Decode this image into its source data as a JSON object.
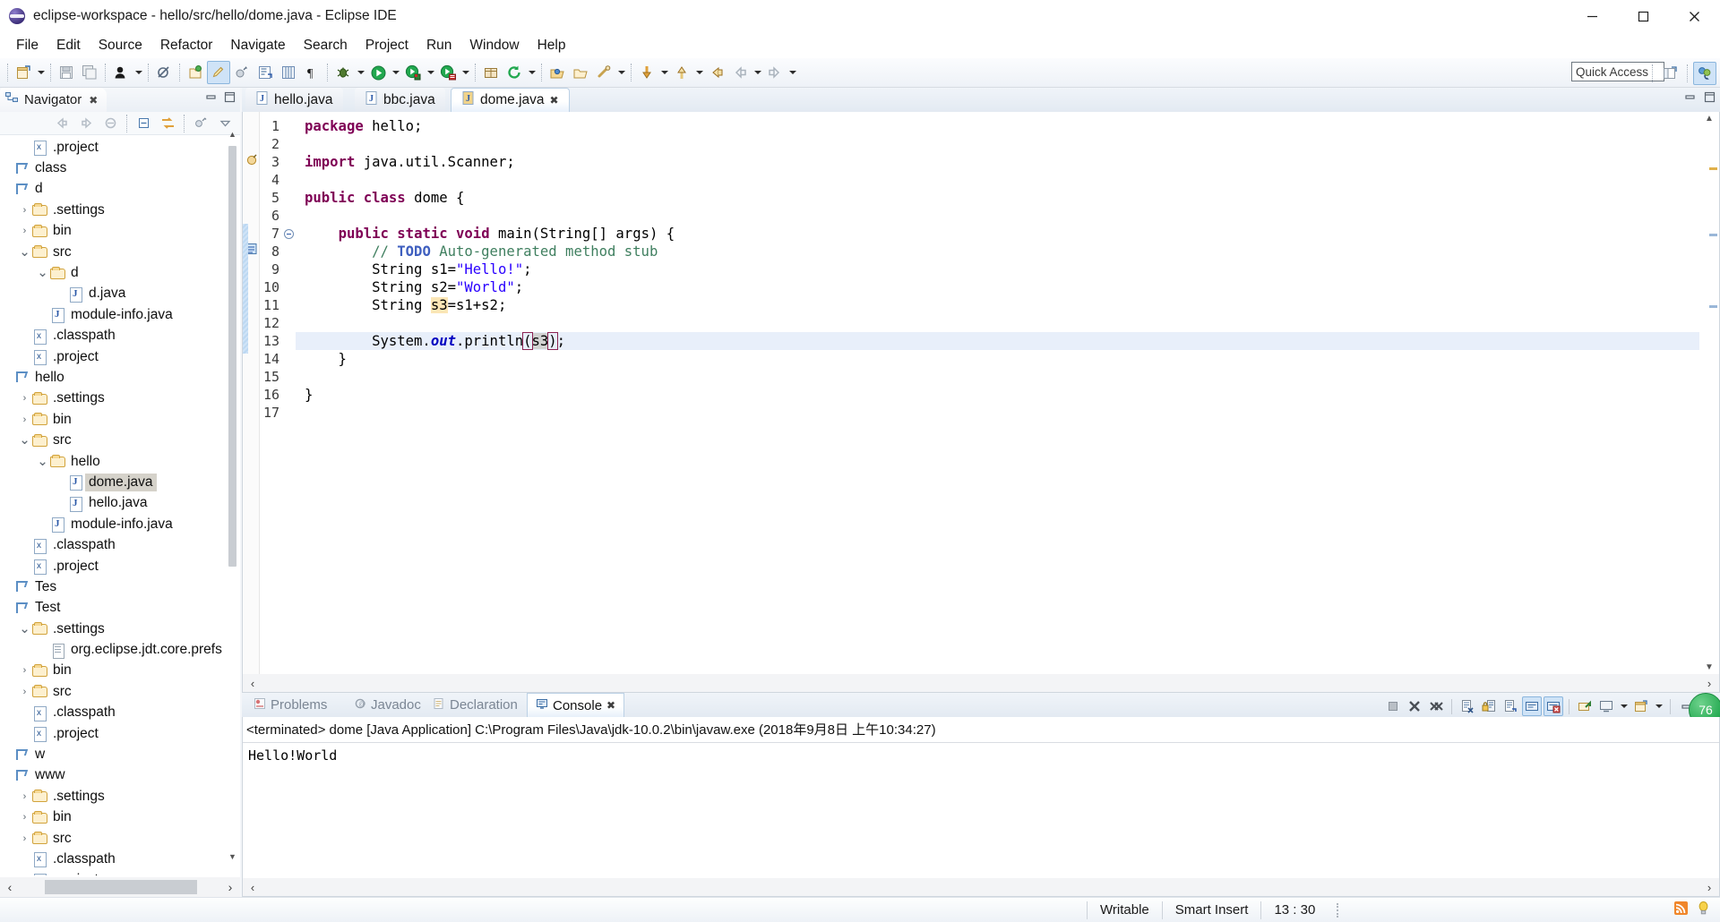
{
  "window": {
    "title": "eclipse-workspace - hello/src/hello/dome.java - Eclipse IDE",
    "logo": "eclipse-logo",
    "minimize": "minimize-icon",
    "maximize": "maximize-icon",
    "close": "close-icon"
  },
  "menubar": {
    "items": [
      {
        "label": "File"
      },
      {
        "label": "Edit"
      },
      {
        "label": "Source"
      },
      {
        "label": "Refactor"
      },
      {
        "label": "Navigate"
      },
      {
        "label": "Search"
      },
      {
        "label": "Project"
      },
      {
        "label": "Run"
      },
      {
        "label": "Window"
      },
      {
        "label": "Help"
      }
    ]
  },
  "toolbar": {
    "quick_access_placeholder": "Quick Access",
    "items": [
      {
        "name": "new-wizard-icon"
      },
      {
        "name": "new-dropdown-icon"
      },
      {
        "name": "save-icon"
      },
      {
        "name": "save-all-icon"
      },
      {
        "name": "toggle-breadcrumb-icon"
      },
      {
        "name": "breadcrumb-dropdown-icon"
      },
      {
        "name": "skip-breakpoints-icon"
      },
      {
        "name": "new-java-project-icon"
      },
      {
        "name": "new-java-class-icon"
      },
      {
        "name": "new-annotation-icon"
      },
      {
        "name": "open-type-icon"
      },
      {
        "name": "show-whitespace-icon"
      },
      {
        "name": "debug-icon"
      },
      {
        "name": "debug-dropdown-icon"
      },
      {
        "name": "run-icon"
      },
      {
        "name": "run-dropdown-icon"
      },
      {
        "name": "run-coverage-icon"
      },
      {
        "name": "coverage-dropdown-icon"
      },
      {
        "name": "external-tools-icon"
      },
      {
        "name": "external-tools-dropdown-icon"
      },
      {
        "name": "new-package-icon"
      },
      {
        "name": "refresh-icon"
      },
      {
        "name": "refresh-dropdown-icon"
      },
      {
        "name": "open-task-icon"
      },
      {
        "name": "open-folder-icon"
      },
      {
        "name": "link-icon"
      },
      {
        "name": "link-dropdown-icon"
      },
      {
        "name": "next-annotation-icon"
      },
      {
        "name": "next-dropdown-icon"
      },
      {
        "name": "previous-annotation-icon"
      },
      {
        "name": "previous-dropdown-icon"
      },
      {
        "name": "last-edit-location-icon"
      },
      {
        "name": "back-icon"
      },
      {
        "name": "back-dropdown-icon"
      },
      {
        "name": "forward-icon"
      },
      {
        "name": "forward-dropdown-icon"
      }
    ],
    "perspective": [
      {
        "name": "open-perspective-icon"
      },
      {
        "name": "java-perspective-icon"
      }
    ]
  },
  "navigator": {
    "tab_label": "Navigator",
    "tab_icon": "navigator-icon",
    "close_icon": "close-icon",
    "minimize_icon": "minimize-view-icon",
    "maximize_icon": "maximize-view-icon",
    "toolbar": [
      {
        "name": "back-icon"
      },
      {
        "name": "forward-icon"
      },
      {
        "name": "home-icon"
      },
      {
        "name": "collapse-all-icon"
      },
      {
        "name": "link-with-editor-icon"
      },
      {
        "name": "filters-icon"
      },
      {
        "name": "view-menu-icon"
      }
    ],
    "tree": [
      {
        "indent": 1,
        "twisty": "",
        "icon": "x-file-icon",
        "label": ".project",
        "selected": false
      },
      {
        "indent": 0,
        "twisty": "",
        "icon": "project-icon",
        "label": "class",
        "selected": false
      },
      {
        "indent": 0,
        "twisty": "",
        "icon": "project-icon",
        "label": "d",
        "selected": false
      },
      {
        "indent": 1,
        "twisty": ">",
        "icon": "folder-icon",
        "label": ".settings",
        "selected": false
      },
      {
        "indent": 1,
        "twisty": ">",
        "icon": "folder-icon",
        "label": "bin",
        "selected": false
      },
      {
        "indent": 1,
        "twisty": "v",
        "icon": "folder-icon",
        "label": "src",
        "selected": false
      },
      {
        "indent": 2,
        "twisty": "v",
        "icon": "folder-icon",
        "label": "d",
        "selected": false
      },
      {
        "indent": 3,
        "twisty": "",
        "icon": "java-file-icon",
        "label": "d.java",
        "selected": false
      },
      {
        "indent": 2,
        "twisty": "",
        "icon": "java-file-icon",
        "label": "module-info.java",
        "selected": false
      },
      {
        "indent": 1,
        "twisty": "",
        "icon": "x-file-icon",
        "label": ".classpath",
        "selected": false
      },
      {
        "indent": 1,
        "twisty": "",
        "icon": "x-file-icon",
        "label": ".project",
        "selected": false
      },
      {
        "indent": 0,
        "twisty": "",
        "icon": "project-icon",
        "label": "hello",
        "selected": false
      },
      {
        "indent": 1,
        "twisty": ">",
        "icon": "folder-icon",
        "label": ".settings",
        "selected": false
      },
      {
        "indent": 1,
        "twisty": ">",
        "icon": "folder-icon",
        "label": "bin",
        "selected": false
      },
      {
        "indent": 1,
        "twisty": "v",
        "icon": "folder-icon",
        "label": "src",
        "selected": false
      },
      {
        "indent": 2,
        "twisty": "v",
        "icon": "folder-icon",
        "label": "hello",
        "selected": false
      },
      {
        "indent": 3,
        "twisty": "",
        "icon": "java-file-icon",
        "label": "dome.java",
        "selected": true
      },
      {
        "indent": 3,
        "twisty": "",
        "icon": "java-file-icon",
        "label": "hello.java",
        "selected": false
      },
      {
        "indent": 2,
        "twisty": "",
        "icon": "java-file-icon",
        "label": "module-info.java",
        "selected": false
      },
      {
        "indent": 1,
        "twisty": "",
        "icon": "x-file-icon",
        "label": ".classpath",
        "selected": false
      },
      {
        "indent": 1,
        "twisty": "",
        "icon": "x-file-icon",
        "label": ".project",
        "selected": false
      },
      {
        "indent": 0,
        "twisty": "",
        "icon": "project-icon",
        "label": "Tes",
        "selected": false
      },
      {
        "indent": 0,
        "twisty": "",
        "icon": "project-icon",
        "label": "Test",
        "selected": false
      },
      {
        "indent": 1,
        "twisty": "v",
        "icon": "folder-icon",
        "label": ".settings",
        "selected": false
      },
      {
        "indent": 2,
        "twisty": "",
        "icon": "text-file-icon",
        "label": "org.eclipse.jdt.core.prefs",
        "selected": false
      },
      {
        "indent": 1,
        "twisty": ">",
        "icon": "folder-icon",
        "label": "bin",
        "selected": false
      },
      {
        "indent": 1,
        "twisty": ">",
        "icon": "folder-icon",
        "label": "src",
        "selected": false
      },
      {
        "indent": 1,
        "twisty": "",
        "icon": "x-file-icon",
        "label": ".classpath",
        "selected": false
      },
      {
        "indent": 1,
        "twisty": "",
        "icon": "x-file-icon",
        "label": ".project",
        "selected": false
      },
      {
        "indent": 0,
        "twisty": "",
        "icon": "project-icon",
        "label": "w",
        "selected": false
      },
      {
        "indent": 0,
        "twisty": "",
        "icon": "project-icon",
        "label": "www",
        "selected": false
      },
      {
        "indent": 1,
        "twisty": ">",
        "icon": "folder-icon",
        "label": ".settings",
        "selected": false
      },
      {
        "indent": 1,
        "twisty": ">",
        "icon": "folder-icon",
        "label": "bin",
        "selected": false
      },
      {
        "indent": 1,
        "twisty": ">",
        "icon": "folder-icon",
        "label": "src",
        "selected": false
      },
      {
        "indent": 1,
        "twisty": "",
        "icon": "x-file-icon",
        "label": ".classpath",
        "selected": false
      },
      {
        "indent": 1,
        "twisty": "",
        "icon": "x-file-icon",
        "label": ".project",
        "selected": false
      }
    ],
    "hscroll_left": "‹",
    "hscroll_right": "›"
  },
  "editor": {
    "tabs": [
      {
        "label": "hello.java",
        "icon": "java-file-icon",
        "active": false,
        "closable": false
      },
      {
        "label": "bbc.java",
        "icon": "java-file-icon",
        "active": false,
        "closable": false
      },
      {
        "label": "dome.java",
        "icon": "java-file-icon-active",
        "active": true,
        "closable": true
      }
    ],
    "close_icon": "close-icon",
    "minimize_icon": "minimize-view-icon",
    "maximize_icon": "maximize-view-icon",
    "line_numbers": [
      "1",
      "2",
      "3",
      "4",
      "5",
      "6",
      "7",
      "8",
      "9",
      "10",
      "11",
      "12",
      "13",
      "14",
      "15",
      "16",
      "17"
    ],
    "fold_markers": {
      "7": "collapse-marker"
    },
    "markers": {
      "3": "warning-marker",
      "8": "todo-marker"
    },
    "current_line": 13,
    "lines": [
      {
        "n": 1,
        "text": "package hello;"
      },
      {
        "n": 2,
        "text": ""
      },
      {
        "n": 3,
        "text": "import java.util.Scanner;"
      },
      {
        "n": 4,
        "text": ""
      },
      {
        "n": 5,
        "text": "public class dome {"
      },
      {
        "n": 6,
        "text": ""
      },
      {
        "n": 7,
        "text": "    public static void main(String[] args) {"
      },
      {
        "n": 8,
        "text": "        // TODO Auto-generated method stub"
      },
      {
        "n": 9,
        "text": "        String s1=\"Hello!\";"
      },
      {
        "n": 10,
        "text": "        String s2=\"World\";"
      },
      {
        "n": 11,
        "text": "        String s3=s1+s2;"
      },
      {
        "n": 12,
        "text": ""
      },
      {
        "n": 13,
        "text": "        System.out.println(s3);"
      },
      {
        "n": 14,
        "text": "    }"
      },
      {
        "n": 15,
        "text": ""
      },
      {
        "n": 16,
        "text": "}"
      },
      {
        "n": 17,
        "text": ""
      }
    ],
    "hscroll_left": "‹",
    "hscroll_right": "›"
  },
  "bottom": {
    "tabs": [
      {
        "label": "Problems",
        "icon": "problems-icon",
        "active": false
      },
      {
        "label": "Javadoc",
        "icon": "javadoc-icon",
        "active": false
      },
      {
        "label": "Declaration",
        "icon": "declaration-icon",
        "active": false
      },
      {
        "label": "Console",
        "icon": "console-icon",
        "active": true
      }
    ],
    "close_icon": "close-icon",
    "console": {
      "header": "<terminated> dome [Java Application] C:\\Program Files\\Java\\jdk-10.0.2\\bin\\javaw.exe (2018年9月8日 上午10:34:27)",
      "output": "Hello!World"
    },
    "toolbar": [
      {
        "name": "terminate-icon",
        "active": false
      },
      {
        "name": "remove-launch-icon",
        "active": false
      },
      {
        "name": "remove-all-launches-icon",
        "active": false
      },
      {
        "name": "clear-console-icon",
        "active": false
      },
      {
        "name": "scroll-lock-icon",
        "active": false
      },
      {
        "name": "word-wrap-icon",
        "active": false
      },
      {
        "name": "show-console-on-output-icon",
        "active": true
      },
      {
        "name": "show-console-on-error-icon",
        "active": true
      },
      {
        "name": "pin-console-icon",
        "active": false
      },
      {
        "name": "display-selected-console-icon",
        "active": false
      },
      {
        "name": "display-console-dropdown-icon",
        "active": false
      },
      {
        "name": "open-console-icon",
        "active": false
      },
      {
        "name": "open-console-dropdown-icon",
        "active": false
      },
      {
        "name": "minimize-view-icon",
        "active": false
      },
      {
        "name": "maximize-view-icon",
        "active": false
      }
    ],
    "badge": "76"
  },
  "statusbar": {
    "writable": "Writable",
    "insert_mode": "Smart Insert",
    "position": "13 : 30",
    "icons": [
      {
        "name": "rss-feed-icon"
      },
      {
        "name": "tip-of-day-icon"
      }
    ]
  }
}
